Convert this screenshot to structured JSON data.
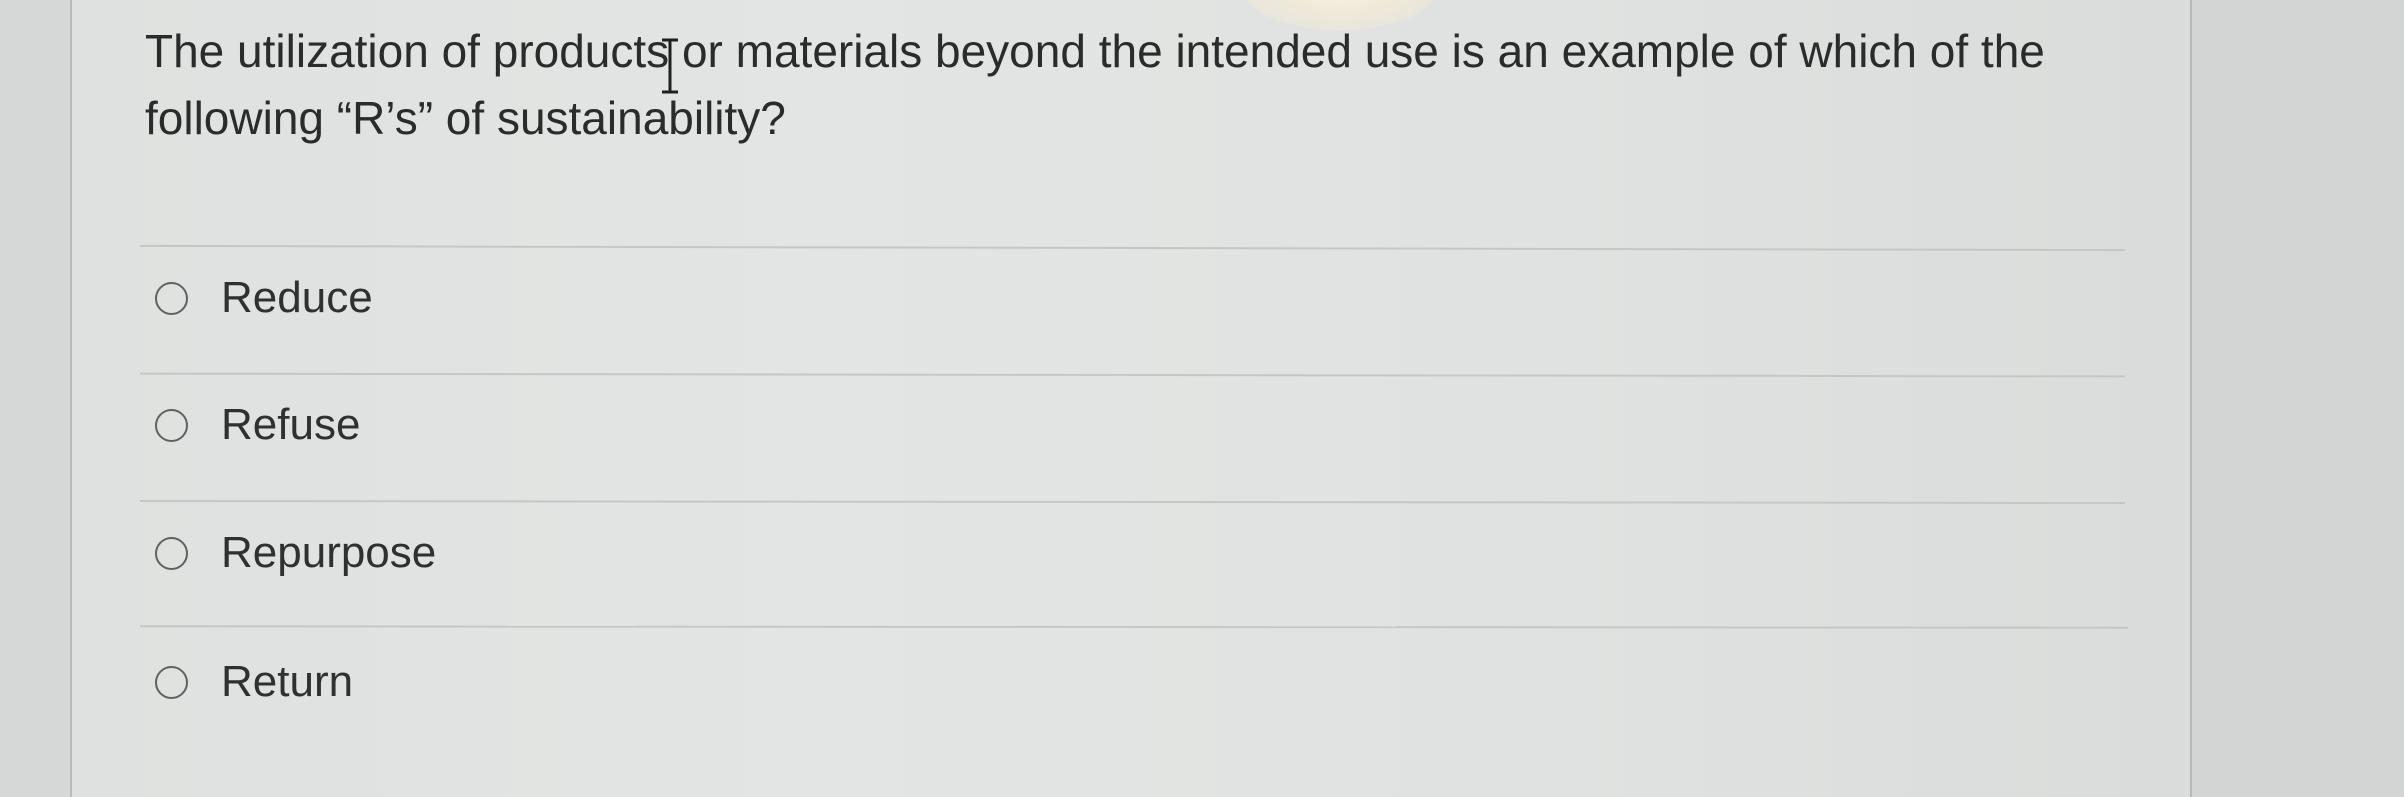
{
  "question": {
    "text": "The utilization of products or materials beyond the intended use is an example of which of the following “R’s” of sustainability?"
  },
  "options": [
    {
      "label": "Reduce",
      "selected": false
    },
    {
      "label": "Refuse",
      "selected": false
    },
    {
      "label": "Repurpose",
      "selected": false
    },
    {
      "label": "Return",
      "selected": false
    }
  ],
  "cursor": {
    "type": "text-cursor-icon"
  },
  "colors": {
    "text": "#2a2c2b",
    "background": "#e1e3e2",
    "divider": "#c5c7c6",
    "radio_border": "#5e6261"
  }
}
